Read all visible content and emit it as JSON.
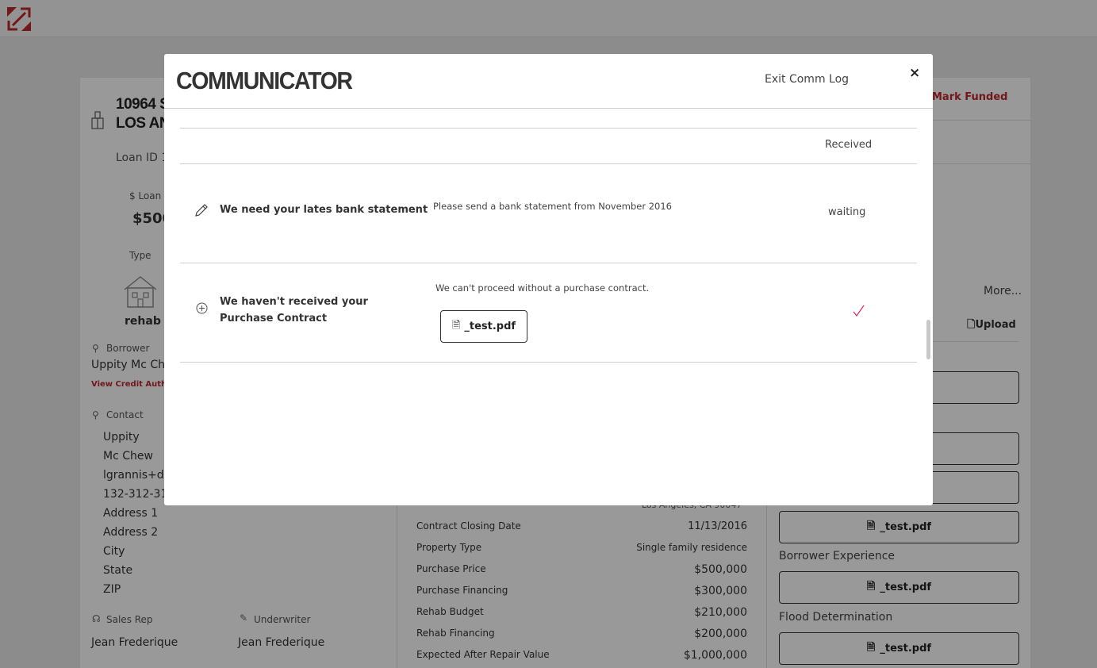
{
  "app": {
    "logo_icon": "brand-logo-icon",
    "brand_color": "#c1272d"
  },
  "loan": {
    "address_line1": "10964 S",
    "address_line2": "LOS ANG",
    "loan_id_label": "Loan ID 1",
    "loan_amount_label": "$ Loan",
    "loan_amount_value": "$500",
    "type_label": "Type",
    "type_value": "rehab",
    "mark_funded": "Mark Funded",
    "more_link": "More...",
    "upload_label": "Upload"
  },
  "borrower": {
    "label": "Borrower",
    "name": "Uppity Mc Ch",
    "credit_link": "View Credit Author"
  },
  "contact": {
    "label": "Contact",
    "first_name": "Uppity",
    "last_name": "Mc Chew",
    "email": "lgrannis+de",
    "phone": "132-312-31",
    "address1": "Address 1",
    "address2": "Address 2",
    "city": "City",
    "state": "State",
    "zip": "ZIP"
  },
  "team": {
    "sales_rep_label": "Sales Rep",
    "sales_rep_name": "Jean Frederique",
    "underwriter_label": "Underwriter",
    "underwriter_name": "Jean Frederique"
  },
  "details": {
    "partial_address": "Los Angeles, CA 90047",
    "rows": [
      {
        "label": "Contract Closing Date",
        "value": "11/13/2016"
      },
      {
        "label": "Property Type",
        "value": "Single family residence"
      },
      {
        "label": "Purchase Price",
        "value": "$500,000"
      },
      {
        "label": "Purchase Financing",
        "value": "$300,000"
      },
      {
        "label": "Rehab Budget",
        "value": "$210,000"
      },
      {
        "label": "Rehab Financing",
        "value": "$200,000"
      },
      {
        "label": "Expected After Repair Value",
        "value": "$1,000,000"
      }
    ]
  },
  "documents": {
    "file_name": "_test.pdf",
    "borrower_experience_label": "Borrower Experience",
    "flood_determination_label": "Flood Determination"
  },
  "modal": {
    "title": "COMMUNICATOR",
    "exit_label": "Exit Comm Log",
    "close_label": "×",
    "rows": [
      {
        "title": "",
        "description": "",
        "status": "Received"
      },
      {
        "icon": "pencil-icon",
        "title": "We need your lates bank statement",
        "description": "Please send a bank statement from November 2016",
        "status": "waiting"
      },
      {
        "icon": "plus-circle-icon",
        "title": "We haven't received your Purchase Contract",
        "description": "We can't proceed without a purchase contract.",
        "attachment": "_test.pdf",
        "status_icon": "checkmark-icon"
      }
    ]
  }
}
